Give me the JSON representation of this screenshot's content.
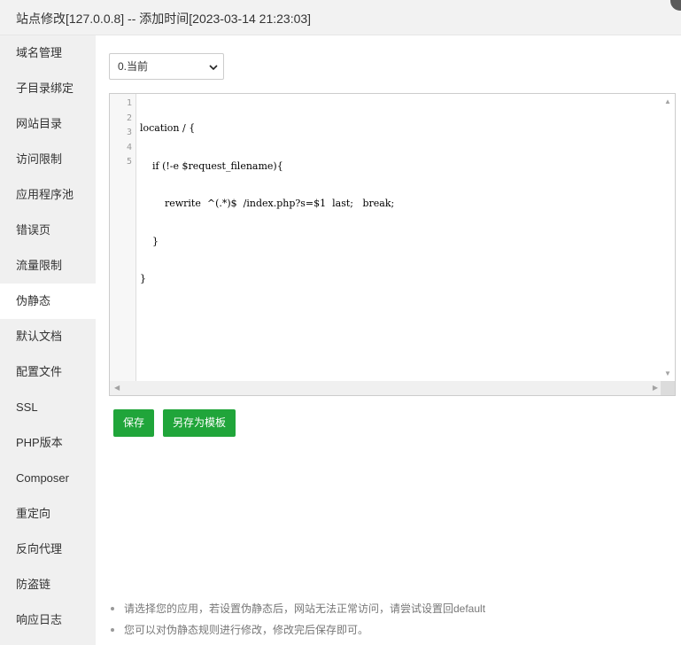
{
  "window": {
    "title": "站点修改[127.0.0.8] -- 添加时间[2023-03-14 21:23:03]"
  },
  "sidebar": {
    "items": [
      {
        "label": "域名管理"
      },
      {
        "label": "子目录绑定"
      },
      {
        "label": "网站目录"
      },
      {
        "label": "访问限制"
      },
      {
        "label": "应用程序池"
      },
      {
        "label": "错误页"
      },
      {
        "label": "流量限制"
      },
      {
        "label": "伪静态",
        "active": true
      },
      {
        "label": "默认文档"
      },
      {
        "label": "配置文件"
      },
      {
        "label": "SSL"
      },
      {
        "label": "PHP版本"
      },
      {
        "label": "Composer"
      },
      {
        "label": "重定向"
      },
      {
        "label": "反向代理"
      },
      {
        "label": "防盗链"
      },
      {
        "label": "响应日志"
      }
    ]
  },
  "rewrite": {
    "template_select": {
      "selected": "0.当前"
    },
    "editor": {
      "line_numbers": [
        "1",
        "2",
        "3",
        "4",
        "5"
      ],
      "lines": [
        "location / {",
        "    if (!-e $request_filename){",
        "        rewrite  ^(.*)$  /index.php?s=$1  last;   break;",
        "    }",
        "}"
      ]
    },
    "save_label": "保存",
    "save_as_template_label": "另存为模板",
    "tips": [
      "请选择您的应用，若设置伪静态后，网站无法正常访问，请尝试设置回default",
      "您可以对伪静态规则进行修改，修改完后保存即可。"
    ]
  },
  "colors": {
    "accent": "#20a53a",
    "sidebar_bg": "#f0f0f0",
    "titlebar_bg": "#f2f2f2"
  }
}
